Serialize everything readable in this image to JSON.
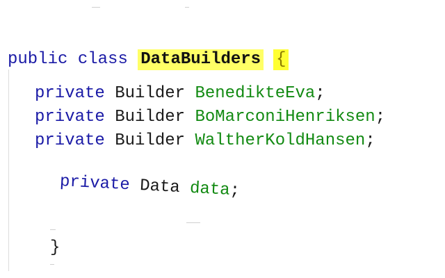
{
  "code": {
    "class_decl": {
      "keyword1": "public",
      "keyword2": "class",
      "class_name": "DataBuilders",
      "open_brace": "{"
    },
    "fields": [
      {
        "modifier": "private",
        "type": "Builder",
        "name": "BenedikteEva",
        "end": ";"
      },
      {
        "modifier": "private",
        "type": "Builder",
        "name": "BoMarconiHenriksen",
        "end": ";"
      },
      {
        "modifier": "private",
        "type": "Builder",
        "name": "WaltherKoldHansen",
        "end": ";"
      }
    ],
    "data_field": {
      "modifier": "private",
      "type": "Data",
      "name": "data",
      "end": ";"
    },
    "close_brace": "}"
  },
  "colors": {
    "keyword": "#1a1aa6",
    "field_name": "#128a12",
    "class_highlight": "#ffff66",
    "brace_highlight": "#ffff33"
  }
}
